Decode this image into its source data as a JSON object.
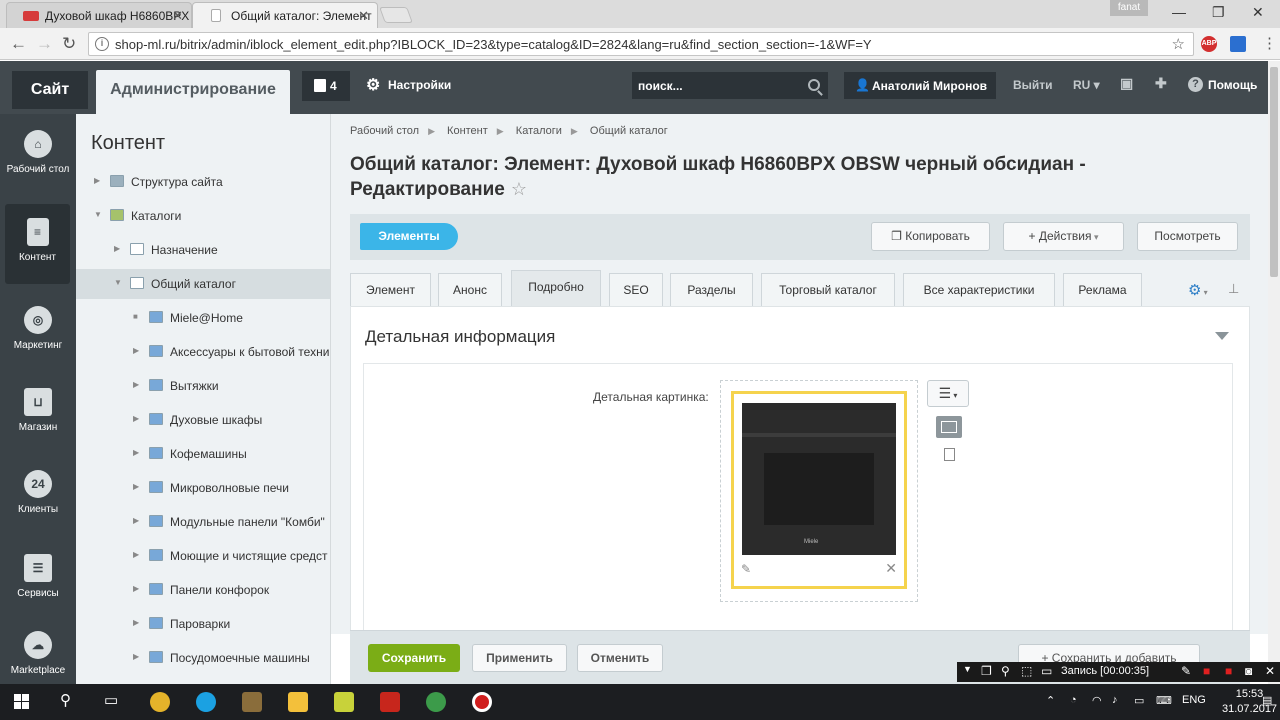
{
  "browser": {
    "tabs": [
      {
        "title": "Духовой шкаф H6860BPX"
      },
      {
        "title": "Общий каталог: Элемент"
      }
    ],
    "url": "shop-ml.ru/bitrix/admin/iblock_element_edit.php?IBLOCK_ID=23&type=catalog&ID=2824&lang=ru&find_section_section=-1&WF=Y",
    "os_user": "fanat",
    "ext_abp": "ABP"
  },
  "panel": {
    "site": "Сайт",
    "admin": "Администрирование",
    "notifications_count": "4",
    "settings": "Настройки",
    "search_placeholder": "поиск...",
    "user": "Анатолий Миронов",
    "logout": "Выйти",
    "lang": "RU",
    "help": "Помощь"
  },
  "leftmenu": {
    "items": [
      {
        "label": "Рабочий стол",
        "icon": "home-icon"
      },
      {
        "label": "Контент",
        "icon": "document-icon"
      },
      {
        "label": "Маркетинг",
        "icon": "target-icon"
      },
      {
        "label": "Магазин",
        "icon": "basket-icon"
      },
      {
        "label": "Клиенты",
        "icon": "clients-24-icon",
        "glyph": "24"
      },
      {
        "label": "Сервисы",
        "icon": "layers-icon"
      },
      {
        "label": "Marketplace",
        "icon": "cloud-download-icon"
      }
    ]
  },
  "tree": {
    "title": "Контент",
    "rows": [
      {
        "label": "Структура сайта",
        "level": 0,
        "icon": "site-structure-icon"
      },
      {
        "label": "Каталоги",
        "level": 0,
        "icon": "catalog-icon",
        "expanded": true
      },
      {
        "label": "Назначение",
        "level": 1,
        "icon": "list-icon"
      },
      {
        "label": "Общий каталог",
        "level": 1,
        "icon": "list-icon",
        "expanded": true,
        "selected": true
      },
      {
        "label": "Miele@Home",
        "level": 2,
        "icon": "folder-icon"
      },
      {
        "label": "Аксессуары к бытовой техни",
        "level": 2,
        "icon": "folder-icon"
      },
      {
        "label": "Вытяжки",
        "level": 2,
        "icon": "folder-icon"
      },
      {
        "label": "Духовые шкафы",
        "level": 2,
        "icon": "folder-icon"
      },
      {
        "label": "Кофемашины",
        "level": 2,
        "icon": "folder-icon"
      },
      {
        "label": "Микроволновые печи",
        "level": 2,
        "icon": "folder-icon"
      },
      {
        "label": "Модульные панели \"Комби\"",
        "level": 2,
        "icon": "folder-icon"
      },
      {
        "label": "Моющие и чистящие средст",
        "level": 2,
        "icon": "folder-icon"
      },
      {
        "label": "Панели конфорок",
        "level": 2,
        "icon": "folder-icon"
      },
      {
        "label": "Пароварки",
        "level": 2,
        "icon": "folder-icon"
      },
      {
        "label": "Посудомоечные машины",
        "level": 2,
        "icon": "folder-icon"
      }
    ]
  },
  "main": {
    "breadcrumbs": [
      "Рабочий стол",
      "Контент",
      "Каталоги",
      "Общий каталог"
    ],
    "title": "Общий каталог: Элемент: Духовой шкаф H6860BPX OBSW черный обсидиан - Редактирование",
    "toolbar": {
      "elements": "Элементы",
      "copy": "Копировать",
      "actions": "Действия",
      "view": "Посмотреть"
    },
    "tabs": [
      "Элемент",
      "Анонс",
      "Подробно",
      "SEO",
      "Разделы",
      "Торговый каталог",
      "Все характеристики",
      "Реклама"
    ],
    "active_tab": "Подробно",
    "section_title": "Детальная информация",
    "picture_label": "Детальная картинка:",
    "picture_brand": "Miele"
  },
  "actions": {
    "save": "Сохранить",
    "apply": "Применить",
    "cancel": "Отменить",
    "save_add": "Сохранить и добавить"
  },
  "recorder": {
    "text": "Запись [00:00:35]"
  },
  "system": {
    "lang": "ENG",
    "time": "15:53",
    "date": "31.07.2017"
  },
  "colors": {
    "accent_blue": "#3bb5e8",
    "save_green": "#7bad16",
    "panel_dark": "#424a4f"
  }
}
